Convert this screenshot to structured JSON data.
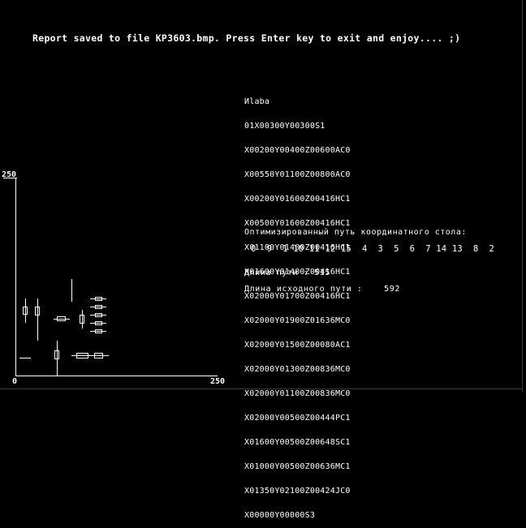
{
  "header": {
    "message": "Report saved to file KP3603.bmp. Press Enter key to exit and enjoy.... ;)"
  },
  "program": {
    "lines": [
      "Иlaba",
      "01X00300Y00300S1",
      "X00200Y00400Z00600AC0",
      "X00550Y01100Z00800AC0",
      "X00200Y01600Z00416HC1",
      "X00500Y01600Z00416HC1",
      "X01100Y01400Z00416HC1",
      "X01600Y01400Z00416HC1",
      "X02000Y01700Z00416HC1",
      "X02000Y01900Z01636MC0",
      "X02000Y01500Z00080AC1",
      "X02000Y01300Z00836MC0",
      "X02000Y01100Z00836MC0",
      "X02000Y00500Z00444PC1",
      "X01600Y00500Z00648SC1",
      "X01000Y00500Z00636MC1",
      "X01350Y02100Z00424JC0",
      "X00000Y00000S3"
    ]
  },
  "optimization": {
    "label": "Оптимизированный путь координатного стола:",
    "sequence": "0  9  1 10 11 12 15  4  3  5  6  7 14 13  8  2"
  },
  "path_length": {
    "label": "Длина пути : ",
    "value": "515"
  },
  "original_length": {
    "label": "Длина исходного пути :",
    "value": "592"
  },
  "plot": {
    "y_max_label": "250",
    "x_min_label": "0",
    "x_max_label": "250",
    "axis_color": "#ffffff",
    "mark_color": "#ffffff"
  }
}
